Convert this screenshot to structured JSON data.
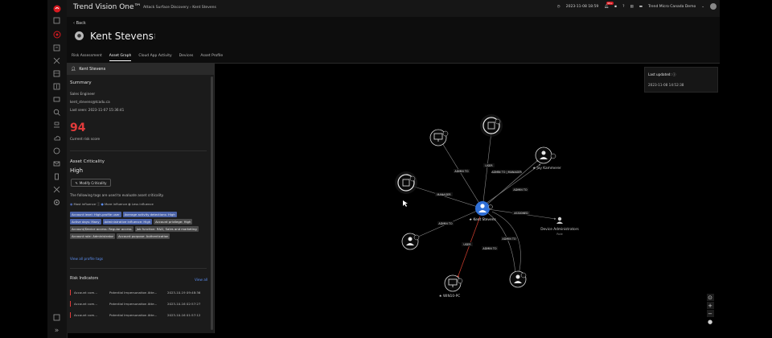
{
  "app": {
    "title": "Trend Vision One™",
    "breadcrumb": "Attack Surface Discovery  ›  Kent Stevens"
  },
  "topbar": {
    "datetime": "2023-11-08 18:59",
    "notification_count": "99+",
    "account": "Trend Micro Canada Demo"
  },
  "header": {
    "back_label": "Back",
    "user_name": "Kent Stevens"
  },
  "tabs": [
    {
      "label": "Risk Assessment",
      "active": false
    },
    {
      "label": "Asset Graph",
      "active": true
    },
    {
      "label": "Cloud App Activity",
      "active": false
    },
    {
      "label": "Devices",
      "active": false
    },
    {
      "label": "Asset Profile",
      "active": false
    }
  ],
  "panel": {
    "title": "Kent Stevens",
    "summary_heading": "Summary",
    "role": "Sales Engineer",
    "email": "kent_stevens@tcadu.ca",
    "last_seen": "Last seen: 2023-11-07 15:36:41",
    "risk_score": "94",
    "risk_score_label": "Current risk score",
    "criticality_heading": "Asset Criticality",
    "criticality_value": "High",
    "modify_button": "Modify Criticality",
    "tags_intro": "The following tags are used to evaluate asset criticality.",
    "legend": {
      "most": "Most influence",
      "more": "More influence",
      "less": "Less influence"
    },
    "tags": [
      {
        "text": "Account level: High-profile user",
        "style": "blue"
      },
      {
        "text": "Average activity detections: High",
        "style": "blue"
      },
      {
        "text": "Active days: Many",
        "style": "blue"
      },
      {
        "text": "Administrative influence: High",
        "style": "blue"
      },
      {
        "text": "Account privilege: High",
        "style": "gray"
      },
      {
        "text": "Account/Device access: Regular access",
        "style": "gray"
      },
      {
        "text": "Job function: R&D, Sales and marketing",
        "style": "gray"
      },
      {
        "text": "Account role: Administrator",
        "style": "gray"
      },
      {
        "text": "Account purpose: Authentication",
        "style": "gray"
      }
    ],
    "view_all_tags": "View all profile tags",
    "risk_indicators_heading": "Risk Indicators",
    "view_all": "View all",
    "indicators": [
      {
        "name": "Account com...",
        "desc": "Potential Impersonation Atte...",
        "time": "2023-10-19 09:48:36"
      },
      {
        "name": "Account com...",
        "desc": "Potential Impersonation Atte...",
        "time": "2023-10-16 02:57:27"
      },
      {
        "name": "Account com...",
        "desc": "Potential Impersonation Atte...",
        "time": "2023-10-16 01:57:12"
      }
    ]
  },
  "last_updated": {
    "label": "Last updated:",
    "value": "2023-11-08 14:52:38"
  },
  "graph": {
    "center_label": "Kent Stevens",
    "node_labels": {
      "jay": "Jay Kammerer",
      "device_admins": "Device Administrators",
      "device_admins_sub": "Role",
      "win10": "WIN10-PC"
    },
    "edge_labels": [
      "ADMIN TO",
      "USER",
      "ADMIN TO | MANAGER",
      "ADMIN TO",
      "MANAGER",
      "ASSIGNED",
      "ADMIN TO",
      "USER",
      "ADMIN TO",
      "ADMIN TO"
    ]
  },
  "colors": {
    "accent": "#2f6fd6",
    "risk": "#e23b3b",
    "tag_blue": "#4a62a8"
  }
}
